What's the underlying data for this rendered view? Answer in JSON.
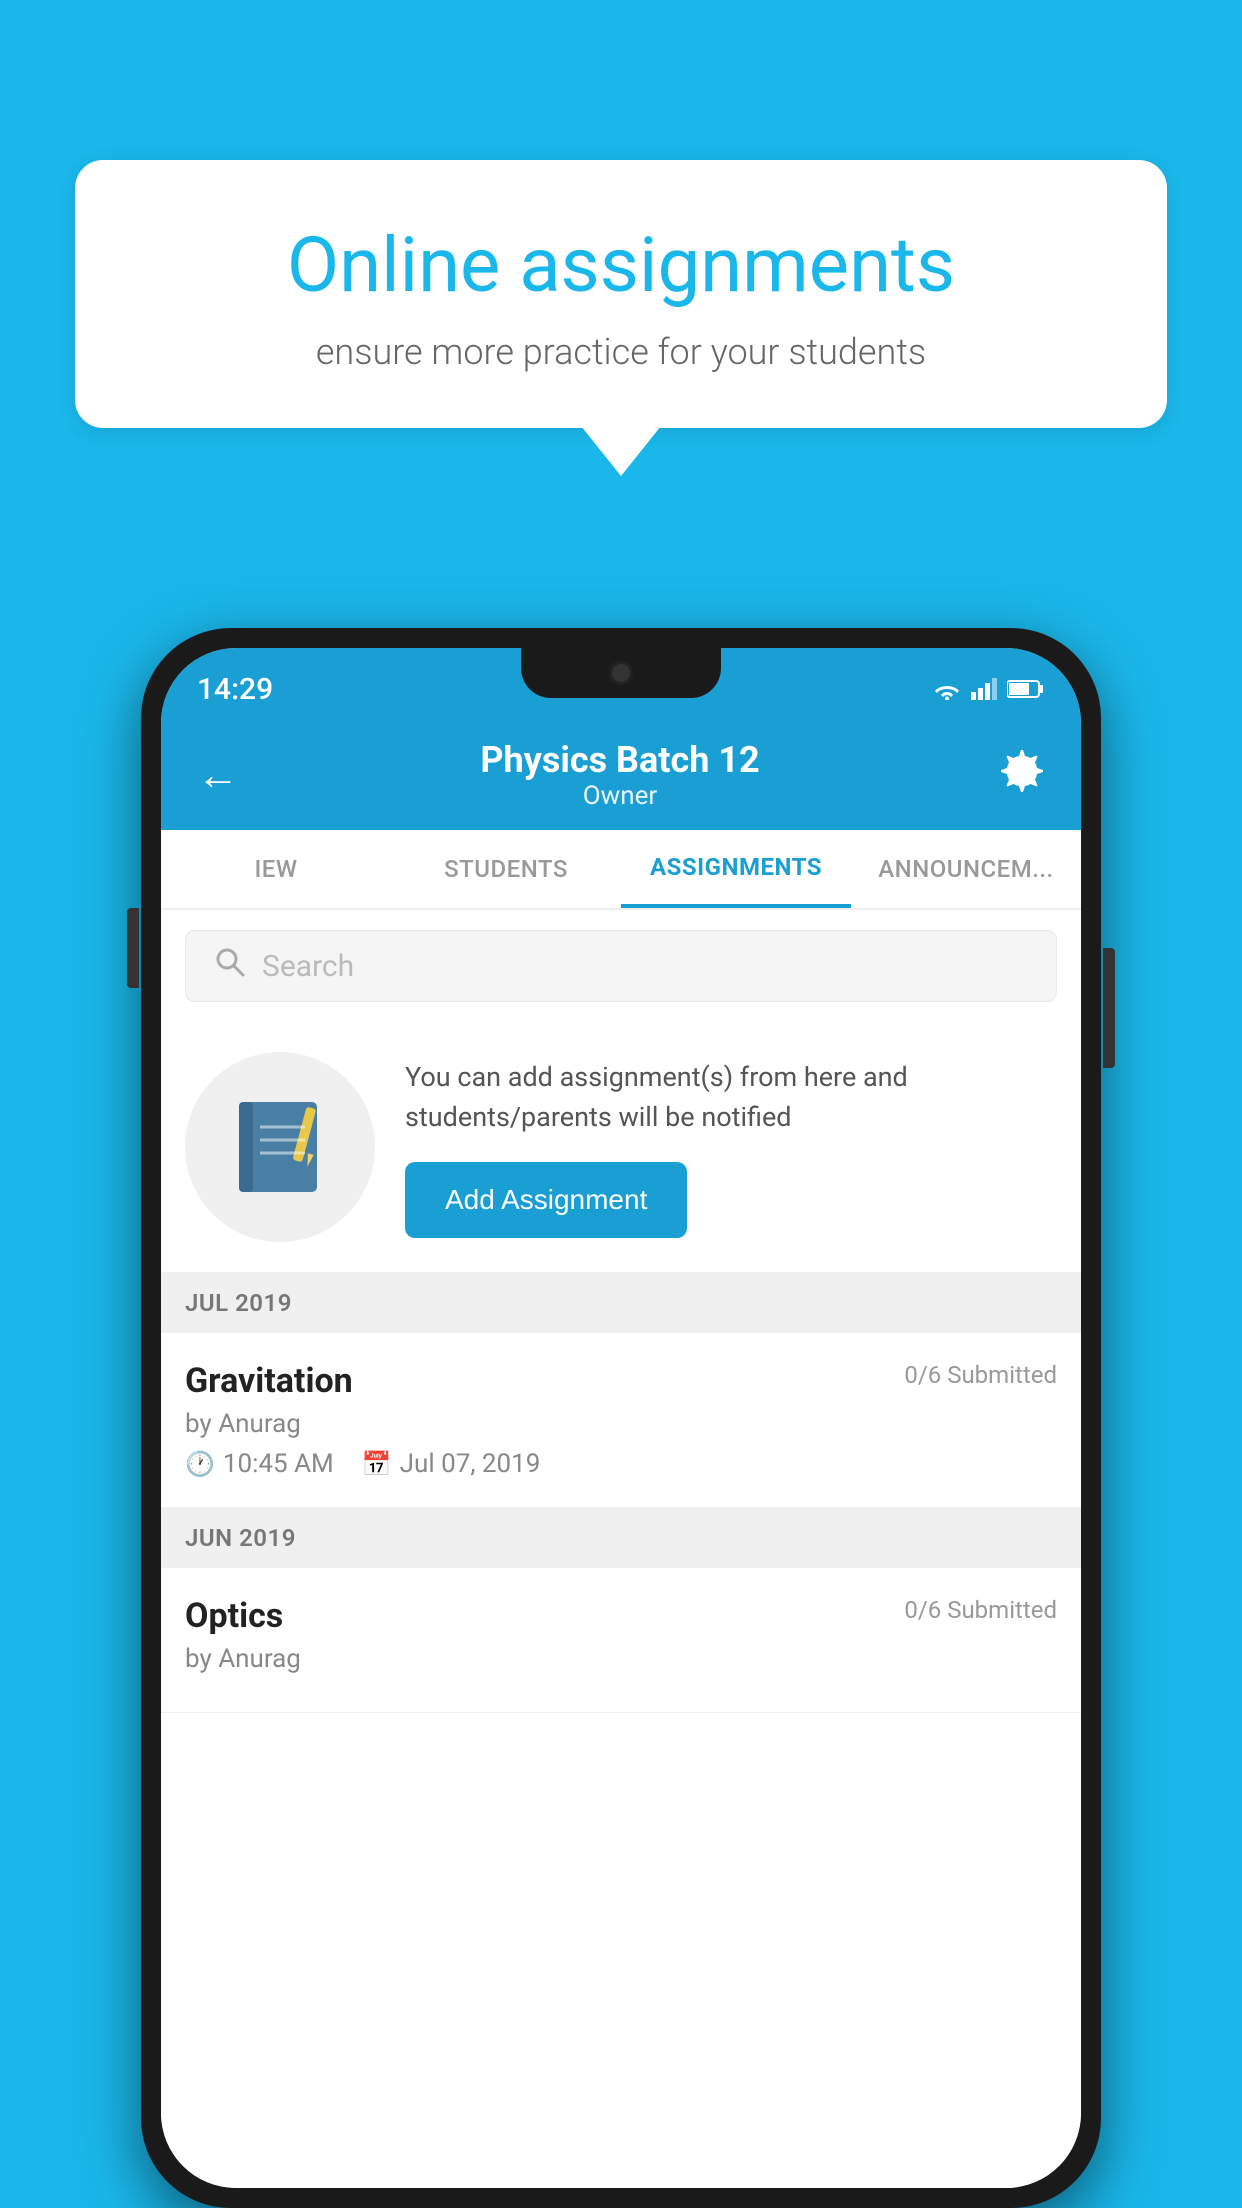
{
  "background": {
    "color": "#1ab7ea"
  },
  "speech_bubble": {
    "title": "Online assignments",
    "subtitle": "ensure more practice for your students"
  },
  "phone": {
    "status_bar": {
      "time": "14:29"
    },
    "header": {
      "title": "Physics Batch 12",
      "subtitle": "Owner",
      "back_label": "←",
      "settings_label": "⚙"
    },
    "tabs": [
      {
        "label": "IEW",
        "active": false
      },
      {
        "label": "STUDENTS",
        "active": false
      },
      {
        "label": "ASSIGNMENTS",
        "active": true
      },
      {
        "label": "ANNOUNCEM...",
        "active": false
      }
    ],
    "search": {
      "placeholder": "Search"
    },
    "promo": {
      "text": "You can add assignment(s) from here and students/parents will be notified",
      "button_label": "Add Assignment"
    },
    "assignments": {
      "sections": [
        {
          "month": "JUL 2019",
          "items": [
            {
              "title": "Gravitation",
              "submitted": "0/6 Submitted",
              "author": "by Anurag",
              "time": "10:45 AM",
              "date": "Jul 07, 2019"
            }
          ]
        },
        {
          "month": "JUN 2019",
          "items": [
            {
              "title": "Optics",
              "submitted": "0/6 Submitted",
              "author": "by Anurag",
              "time": "",
              "date": ""
            }
          ]
        }
      ]
    }
  }
}
